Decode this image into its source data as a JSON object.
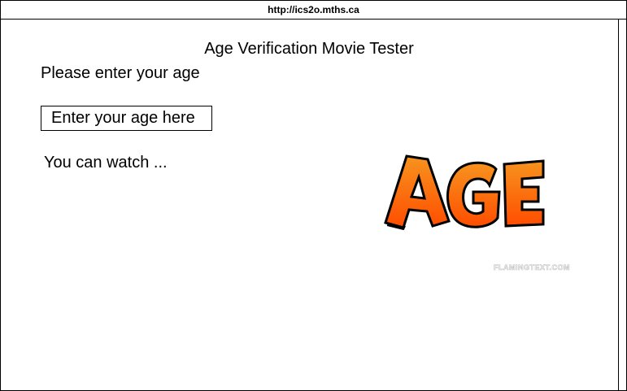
{
  "browser": {
    "url": "http://ics2o.mths.ca"
  },
  "main": {
    "title": "Age Verification Movie Tester",
    "prompt": "Please enter your age",
    "age_input": {
      "value": "",
      "placeholder": "Enter your age here"
    },
    "result_text": "You can watch ...",
    "logo": {
      "text": "AGE",
      "watermark": "FLAMINGTEXT.COM",
      "gradient_top": "#f7931e",
      "gradient_bottom": "#ff5a00",
      "outline": "#000000"
    }
  }
}
